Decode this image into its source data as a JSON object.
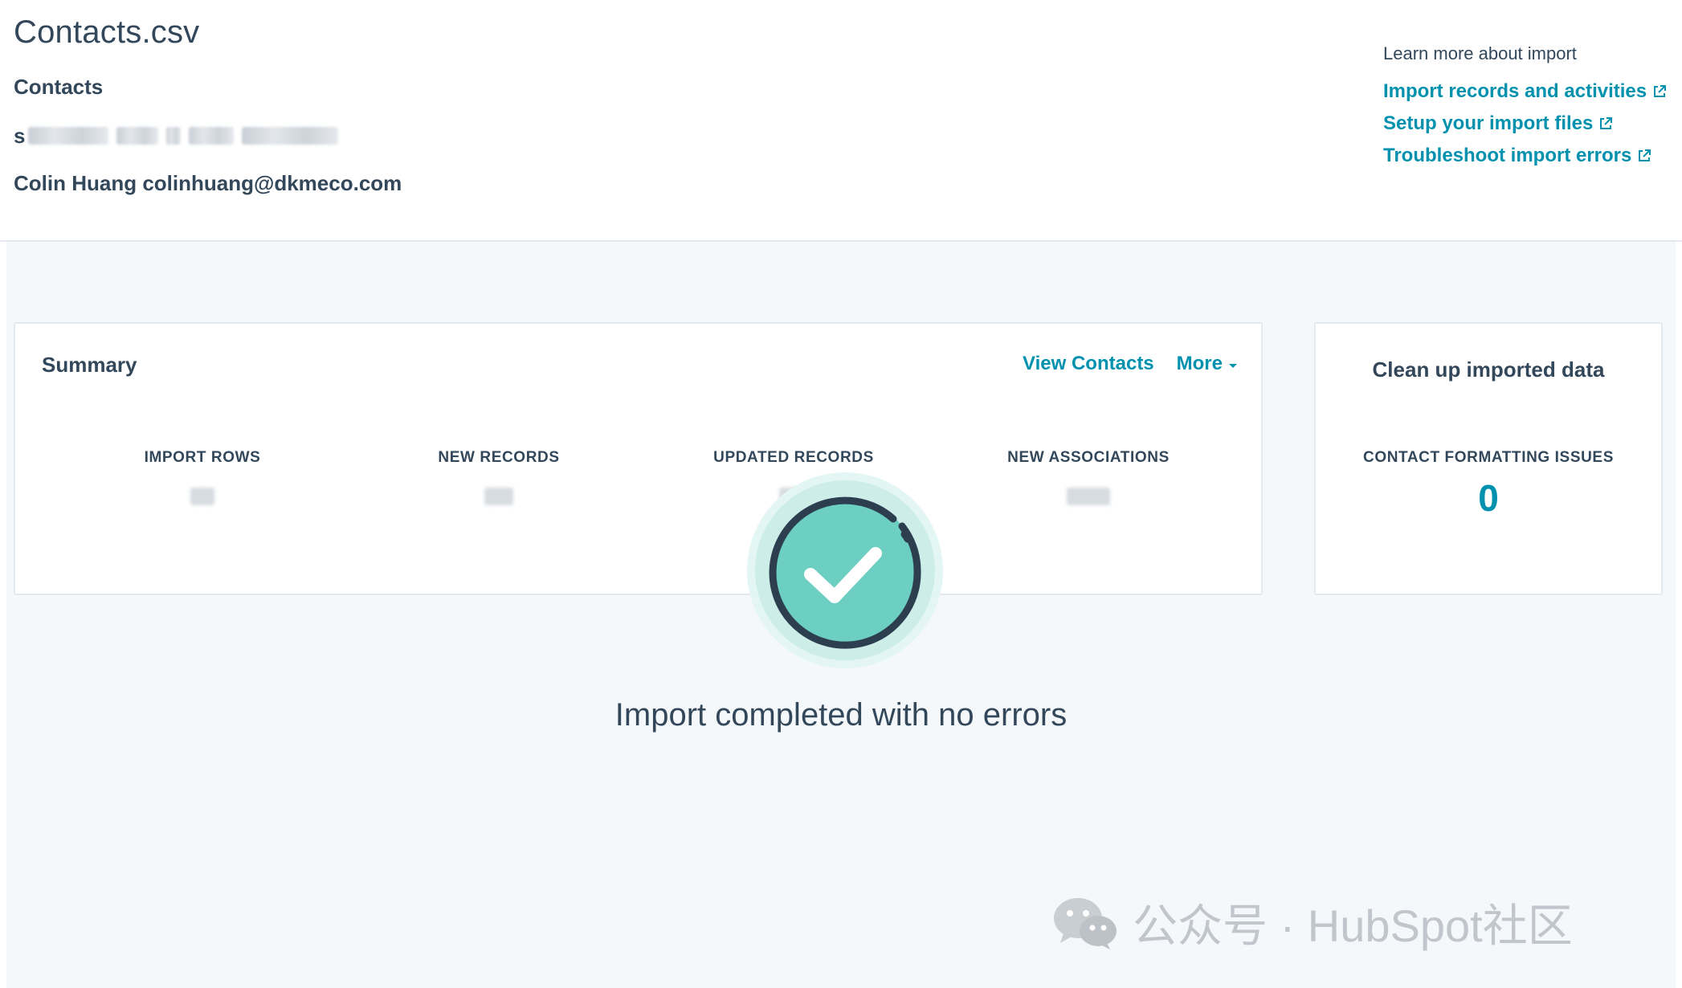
{
  "header": {
    "file_title": "Contacts.csv",
    "object_label": "Contacts",
    "blurred_prefix": "s",
    "owner_line": "Colin Huang colinhuang@dkmeco.com"
  },
  "learn_more": {
    "heading": "Learn more about import",
    "links": [
      "Import records and activities",
      "Setup your import files",
      "Troubleshoot import errors"
    ]
  },
  "summary": {
    "title": "Summary",
    "view_contacts_label": "View Contacts",
    "more_label": "More",
    "stats": [
      {
        "label": "IMPORT ROWS"
      },
      {
        "label": "NEW RECORDS"
      },
      {
        "label": "UPDATED RECORDS"
      },
      {
        "label": "NEW ASSOCIATIONS"
      }
    ]
  },
  "cleanup": {
    "title": "Clean up imported data",
    "label": "CONTACT FORMATTING ISSUES",
    "value": "0"
  },
  "completion": {
    "message": "Import completed with no errors"
  },
  "watermark": {
    "text": "公众号 · HubSpot社区"
  },
  "icons": {
    "external_link": "external-link-icon",
    "caret": "caret-down-icon",
    "success": "check-circle-icon",
    "wechat": "wechat-icon"
  },
  "colors": {
    "link": "#0091ae",
    "text": "#33475b",
    "success_fill": "#6ccfc1",
    "success_halo": "#d6f3ef",
    "main_bg": "#f5f8fa"
  }
}
